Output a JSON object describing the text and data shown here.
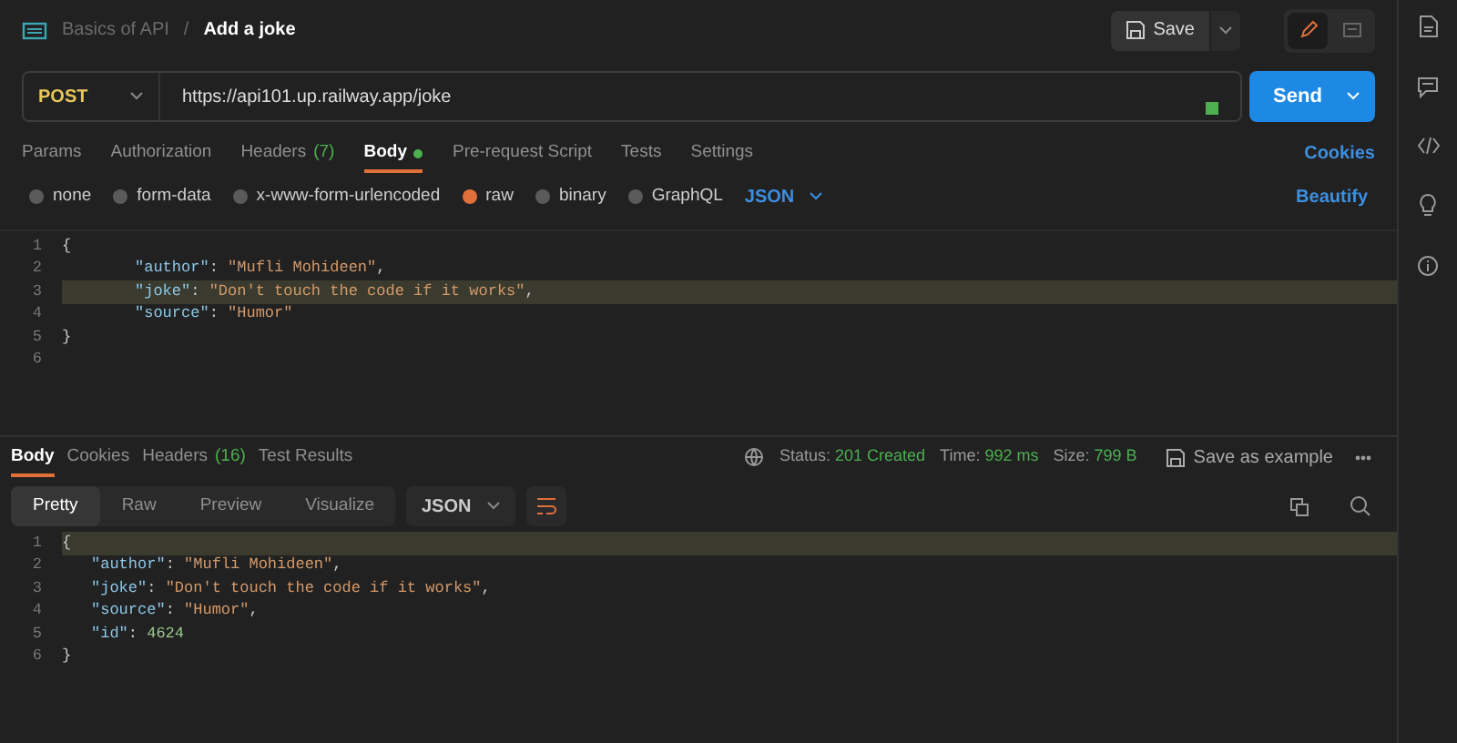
{
  "breadcrumb": {
    "collection": "Basics of API",
    "separator": "/",
    "request": "Add a joke"
  },
  "header_actions": {
    "save": "Save",
    "modes": [
      {
        "kind": "edit",
        "selected": true
      },
      {
        "kind": "comment",
        "selected": false
      }
    ]
  },
  "request": {
    "method": "POST",
    "url": "https://api101.up.railway.app/joke",
    "send": "Send"
  },
  "request_tabs": [
    {
      "label": "Params",
      "selected": false
    },
    {
      "label": "Authorization",
      "selected": false
    },
    {
      "label": "Headers",
      "count": "(7)",
      "selected": false
    },
    {
      "label": "Body",
      "selected": true,
      "dot": true
    },
    {
      "label": "Pre-request Script",
      "selected": false
    },
    {
      "label": "Tests",
      "selected": false
    },
    {
      "label": "Settings",
      "selected": false
    }
  ],
  "cookies_link": "Cookies",
  "body_types": [
    {
      "label": "none",
      "selected": false
    },
    {
      "label": "form-data",
      "selected": false
    },
    {
      "label": "x-www-form-urlencoded",
      "selected": false
    },
    {
      "label": "raw",
      "selected": true
    },
    {
      "label": "binary",
      "selected": false
    },
    {
      "label": "GraphQL",
      "selected": false
    }
  ],
  "body_format": "JSON",
  "beautify": "Beautify",
  "request_body": [
    {
      "number": "1",
      "highlighted": false,
      "indent": false,
      "segments": [
        {
          "kind": "punct",
          "text": "{"
        }
      ]
    },
    {
      "number": "2",
      "highlighted": false,
      "indent": true,
      "segments": [
        {
          "kind": "key",
          "text": "\"author\""
        },
        {
          "kind": "punct",
          "text": ": "
        },
        {
          "kind": "string",
          "text": "\"Mufli Mohideen\""
        },
        {
          "kind": "punct",
          "text": ","
        }
      ]
    },
    {
      "number": "3",
      "highlighted": true,
      "indent": true,
      "segments": [
        {
          "kind": "key",
          "text": "\"joke\""
        },
        {
          "kind": "punct",
          "text": ": "
        },
        {
          "kind": "string",
          "text": "\"Don't touch the code if it works\""
        },
        {
          "kind": "punct",
          "text": ","
        }
      ]
    },
    {
      "number": "4",
      "highlighted": false,
      "indent": true,
      "segments": [
        {
          "kind": "key",
          "text": "\"source\""
        },
        {
          "kind": "punct",
          "text": ": "
        },
        {
          "kind": "string",
          "text": "\"Humor\""
        }
      ]
    },
    {
      "number": "5",
      "highlighted": false,
      "indent": false,
      "segments": [
        {
          "kind": "punct",
          "text": "}"
        }
      ]
    },
    {
      "number": "6",
      "highlighted": false
    }
  ],
  "response_tabs": [
    {
      "label": "Body",
      "selected": true
    },
    {
      "label": "Cookies",
      "selected": false
    },
    {
      "label": "Headers",
      "count": "(16)",
      "selected": false
    },
    {
      "label": "Test Results",
      "selected": false
    }
  ],
  "response_meta": [
    {
      "label": "Status:",
      "value": "201 Created"
    },
    {
      "label": "Time:",
      "value": "992 ms"
    },
    {
      "label": "Size:",
      "value": "799 B"
    }
  ],
  "save_example": "Save as example",
  "view_modes": [
    {
      "label": "Pretty",
      "selected": true
    },
    {
      "label": "Raw",
      "selected": false
    },
    {
      "label": "Preview",
      "selected": false
    },
    {
      "label": "Visualize",
      "selected": false
    }
  ],
  "response_format": "JSON",
  "response_body": [
    {
      "number": "1",
      "highlighted": true,
      "indent": false,
      "segments": [
        {
          "kind": "punct",
          "text": "{"
        }
      ]
    },
    {
      "number": "2",
      "highlighted": false,
      "indent": true,
      "segments": [
        {
          "kind": "key",
          "text": "\"author\""
        },
        {
          "kind": "punct",
          "text": ": "
        },
        {
          "kind": "string",
          "text": "\"Mufli Mohideen\""
        },
        {
          "kind": "punct",
          "text": ","
        }
      ]
    },
    {
      "number": "3",
      "highlighted": false,
      "indent": true,
      "segments": [
        {
          "kind": "key",
          "text": "\"joke\""
        },
        {
          "kind": "punct",
          "text": ": "
        },
        {
          "kind": "string",
          "text": "\"Don't touch the code if it works\""
        },
        {
          "kind": "punct",
          "text": ","
        }
      ]
    },
    {
      "number": "4",
      "highlighted": false,
      "indent": true,
      "segments": [
        {
          "kind": "key",
          "text": "\"source\""
        },
        {
          "kind": "punct",
          "text": ": "
        },
        {
          "kind": "string",
          "text": "\"Humor\""
        },
        {
          "kind": "punct",
          "text": ","
        }
      ]
    },
    {
      "number": "5",
      "highlighted": false,
      "indent": true,
      "segments": [
        {
          "kind": "key",
          "text": "\"id\""
        },
        {
          "kind": "punct",
          "text": ": "
        },
        {
          "kind": "number",
          "text": "4624"
        }
      ]
    },
    {
      "number": "6",
      "highlighted": false,
      "indent": false,
      "segments": [
        {
          "kind": "punct",
          "text": "}"
        }
      ]
    }
  ]
}
